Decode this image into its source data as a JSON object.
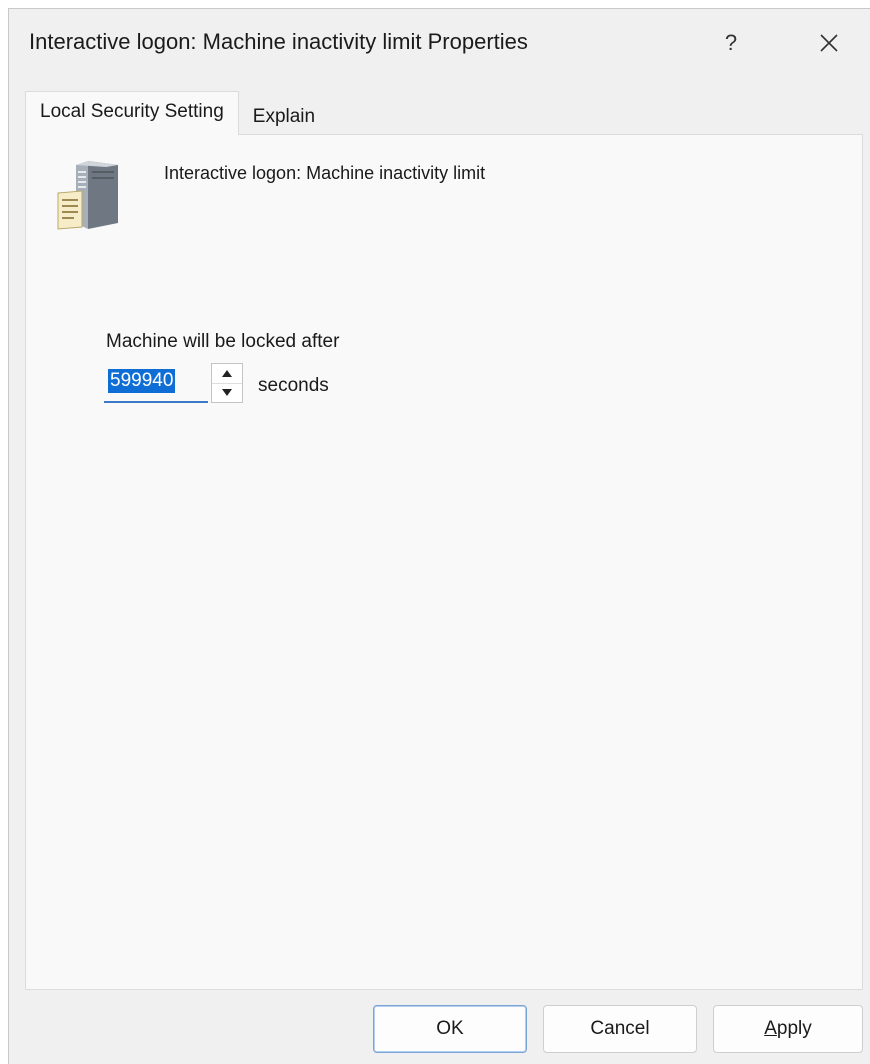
{
  "window": {
    "title": "Interactive logon: Machine inactivity limit Properties",
    "help_label": "?"
  },
  "tabs": [
    {
      "label": "Local Security Setting",
      "active": true
    },
    {
      "label": "Explain",
      "active": false
    }
  ],
  "policy": {
    "name": "Interactive logon: Machine inactivity limit",
    "icon": "server-policy-icon"
  },
  "setting": {
    "label": "Machine will be locked after",
    "value": "599940",
    "unit": "seconds"
  },
  "buttons": {
    "ok": "OK",
    "cancel": "Cancel",
    "apply": "Apply"
  },
  "colors": {
    "selection": "#0f6dd6",
    "input_underline": "#3d78c9",
    "panel_background": "#f9f9f9",
    "window_background": "#f0f0f0"
  }
}
